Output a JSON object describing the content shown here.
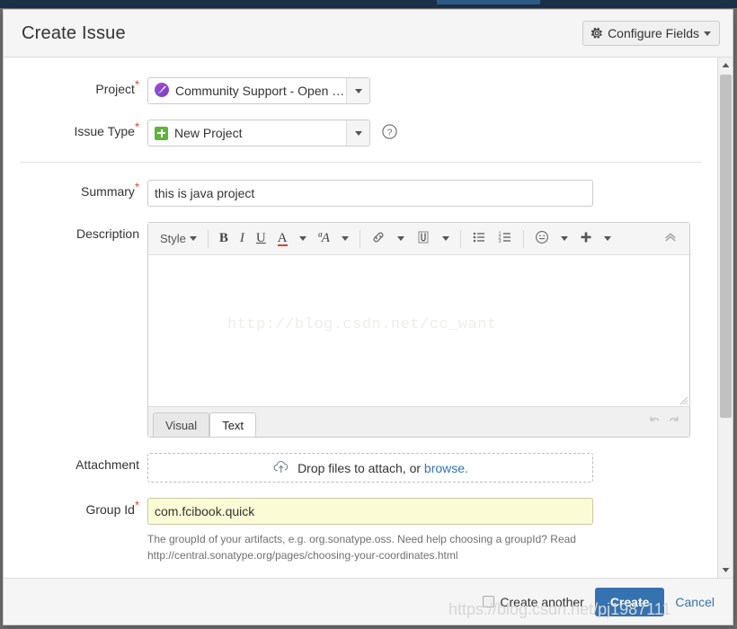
{
  "window": {
    "backdrop_color": "#6e6e6e",
    "topbar_color": "#1b3149"
  },
  "header": {
    "title": "Create Issue",
    "configure_fields_label": "Configure Fields",
    "gear_icon": "gear-icon",
    "caret_icon": "chevron-down-icon"
  },
  "form": {
    "project": {
      "label": "Project",
      "required": true,
      "value": "Community Support - Open …",
      "icon": "project-avatar-icon"
    },
    "issue_type": {
      "label": "Issue Type",
      "required": true,
      "value": "New Project",
      "icon": "new-project-icon",
      "help_icon": "question-circle-icon"
    },
    "summary": {
      "label": "Summary",
      "required": true,
      "value": "this is java project",
      "placeholder": ""
    },
    "description": {
      "label": "Description",
      "required": false,
      "watermark": "http://blog.csdn.net/cc_want",
      "toolbar": [
        {
          "name": "style-dropdown",
          "label": "Style",
          "icon": "chevron-down-icon",
          "type": "dropdown"
        },
        {
          "name": "sep-1",
          "type": "separator"
        },
        {
          "name": "bold-button",
          "label": "B",
          "type": "glyph-bold"
        },
        {
          "name": "italic-button",
          "label": "I",
          "type": "glyph-italic"
        },
        {
          "name": "underline-button",
          "label": "U",
          "type": "glyph-underline"
        },
        {
          "name": "text-color-button",
          "label": "A",
          "type": "glyph-color"
        },
        {
          "name": "text-color-dropdown",
          "label": "",
          "icon": "chevron-down-icon",
          "type": "caret-only"
        },
        {
          "name": "text-effects-button",
          "label": "ªA",
          "type": "glyph-plain"
        },
        {
          "name": "text-effects-dropdown",
          "label": "",
          "icon": "chevron-down-icon",
          "type": "caret-only"
        },
        {
          "name": "sep-2",
          "type": "separator"
        },
        {
          "name": "link-button",
          "icon": "link-icon",
          "type": "icon"
        },
        {
          "name": "link-dropdown",
          "label": "",
          "icon": "chevron-down-icon",
          "type": "caret-only"
        },
        {
          "name": "attach-button",
          "icon": "paperclip-icon",
          "type": "icon"
        },
        {
          "name": "attach-dropdown",
          "label": "",
          "icon": "chevron-down-icon",
          "type": "caret-only"
        },
        {
          "name": "sep-3",
          "type": "separator"
        },
        {
          "name": "bullet-list-button",
          "icon": "bullet-list-icon",
          "type": "icon"
        },
        {
          "name": "numbered-list-button",
          "icon": "numbered-list-icon",
          "type": "icon"
        },
        {
          "name": "sep-4",
          "type": "separator"
        },
        {
          "name": "emoji-button",
          "icon": "emoji-icon",
          "type": "icon"
        },
        {
          "name": "emoji-dropdown",
          "label": "",
          "icon": "chevron-down-icon",
          "type": "caret-only"
        },
        {
          "name": "insert-more-button",
          "icon": "plus-icon",
          "type": "icon"
        },
        {
          "name": "insert-more-dropdown",
          "label": "",
          "icon": "chevron-down-icon",
          "type": "caret-only"
        },
        {
          "name": "collapse-toolbar-button",
          "icon": "chevron-double-up-icon",
          "type": "icon-right"
        }
      ],
      "tabs": [
        {
          "label": "Visual",
          "active": false
        },
        {
          "label": "Text",
          "active": true
        }
      ],
      "undo_icon": "undo-icon",
      "redo_icon": "redo-icon"
    },
    "attachment": {
      "label": "Attachment",
      "required": false,
      "icon": "cloud-upload-icon",
      "drop_text": "Drop files to attach, or ",
      "browse_label": "browse."
    },
    "group_id": {
      "label": "Group Id",
      "required": true,
      "value": "com.fcibook.quick",
      "help_line_1": "The groupId of your artifacts, e.g. org.sonatype.oss. Need help choosing a groupId? Read",
      "help_line_2": "http://central.sonatype.org/pages/choosing-your-coordinates.html"
    }
  },
  "scrollbar": {
    "up_icon": "triangle-up-icon",
    "down_icon": "triangle-down-icon",
    "thumb": "scrollbar-thumb"
  },
  "footer": {
    "create_another_label": "Create another",
    "create_another_checked": false,
    "create_label": "Create",
    "cancel_label": "Cancel",
    "create_button_color": "#3572b0",
    "watermark": "https://blog.csdn.net/pj1987111"
  }
}
